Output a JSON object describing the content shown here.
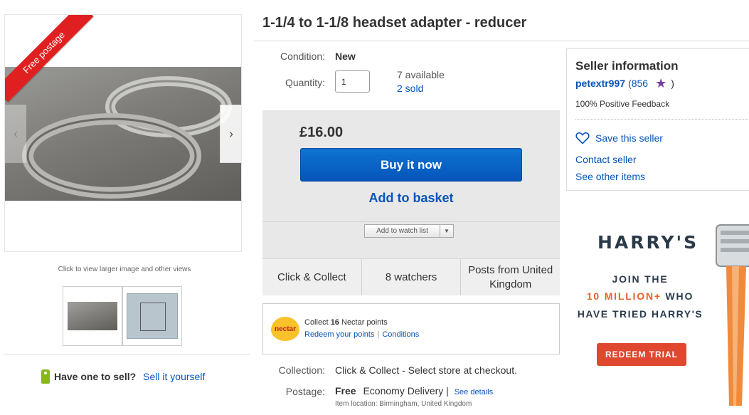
{
  "gallery": {
    "ribbon": "Free postage",
    "view_hint": "Click to view larger image and other views",
    "prev_glyph": "‹",
    "next_glyph": "›"
  },
  "sell": {
    "question": "Have one to sell?",
    "link": "Sell it yourself"
  },
  "listing": {
    "title": "1-1/4 to 1-1/8 headset adapter - reducer",
    "condition_label": "Condition:",
    "condition_value": "New",
    "quantity_label": "Quantity:",
    "quantity_value": "1",
    "available": "7 available",
    "sold": "2 sold"
  },
  "buy_box": {
    "price": "£16.00",
    "buy_now": "Buy it now",
    "add_to_basket": "Add to basket",
    "watch_list": "Add to watch list",
    "info": [
      "Click & Collect",
      "8 watchers",
      "Posts from United Kingdom"
    ]
  },
  "nectar": {
    "logo": "nectar",
    "collect_prefix": "Collect",
    "points": "16",
    "collect_suffix": "Nectar points",
    "redeem": "Redeem your points",
    "separator": "|",
    "conditions": "Conditions"
  },
  "delivery": {
    "collection_label": "Collection:",
    "collection_value": "Click & Collect - Select store at checkout.",
    "postage_label": "Postage:",
    "postage_free": "Free",
    "postage_service": "Economy Delivery |",
    "see_details": "See details",
    "item_location": "Item location:  Birmingham, United Kingdom"
  },
  "seller": {
    "heading": "Seller information",
    "name": "petextr997",
    "score": "(856",
    "score_close": ")",
    "feedback": "100% Positive Feedback",
    "save": "Save this seller",
    "contact": "Contact seller",
    "other_items": "See other items"
  },
  "ad": {
    "brand": "HARRY'S",
    "line1": "JOIN THE",
    "highlight": "10 MILLION+",
    "line2_rest": " WHO",
    "line3": "HAVE TRIED HARRY'S",
    "cta": "REDEEM TRIAL"
  },
  "colors": {
    "link": "#0654ba",
    "buy_button": "#0654ba",
    "ribbon": "#e02020",
    "ad_accent": "#e8612c",
    "ad_cta": "#e0472f",
    "star": "#7b3fa0"
  }
}
